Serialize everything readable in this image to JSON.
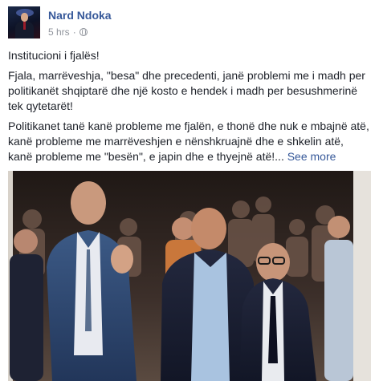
{
  "post": {
    "author": "Nard Ndoka",
    "time": "5 hrs",
    "separator": "·",
    "privacy_icon": "globe-icon",
    "paragraphs": {
      "p1": "Institucioni i fjalës!",
      "p2": "Fjala, marrëveshja, \"besa\" dhe precedenti, janë problemi me i madh per politikanët shqiptarë dhe një kosto e hendek i madh per besushmerinë tek qytetarët!",
      "p3": "Politikanet tanë kanë probleme me fjalën, e thonë dhe nuk e mbajnë atë, kanë probleme me marrëveshjen e nënshkruajnë dhe e shkelin atë, kanë probleme me \"besën\", e japin dhe e thyejnë atë!...",
      "see_more": "See more"
    }
  },
  "colors": {
    "link": "#365899",
    "text": "#1d2129",
    "meta": "#90949c"
  }
}
